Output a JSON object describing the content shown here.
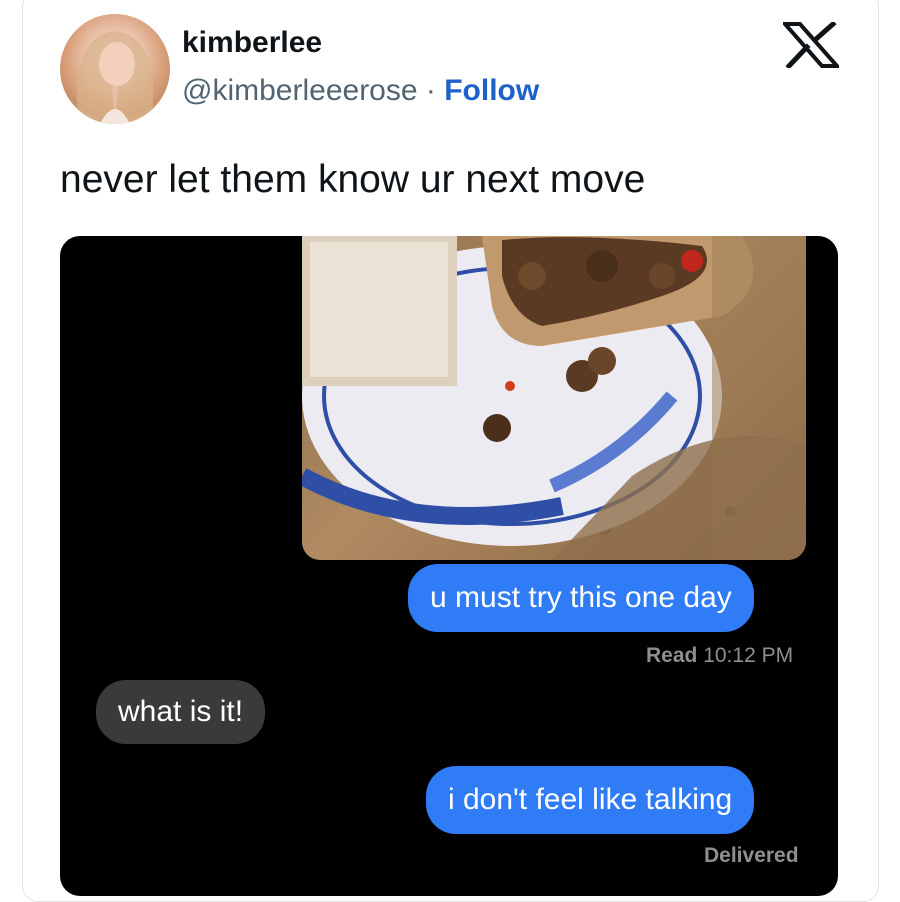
{
  "tweet": {
    "author_name": "kimberlee",
    "handle": "@kimberleeerose",
    "separator": " · ",
    "follow_label": "Follow",
    "text": "never let them know ur next move"
  },
  "icons": {
    "platform_logo": "x-logo-icon",
    "avatar": "profile-photo"
  },
  "colors": {
    "follow": "#1d62c9",
    "outgoing_bubble": "#2f7cf6",
    "incoming_bubble": "#3a3a3c"
  },
  "screenshot": {
    "messages": [
      {
        "direction": "outgoing",
        "text": "u must try this one day"
      },
      {
        "direction": "incoming",
        "text": "what is it!"
      },
      {
        "direction": "outgoing",
        "text": "i don't feel like talking"
      }
    ],
    "read_label": "Read",
    "read_time": "10:12 PM",
    "delivered_label": "Delivered"
  }
}
